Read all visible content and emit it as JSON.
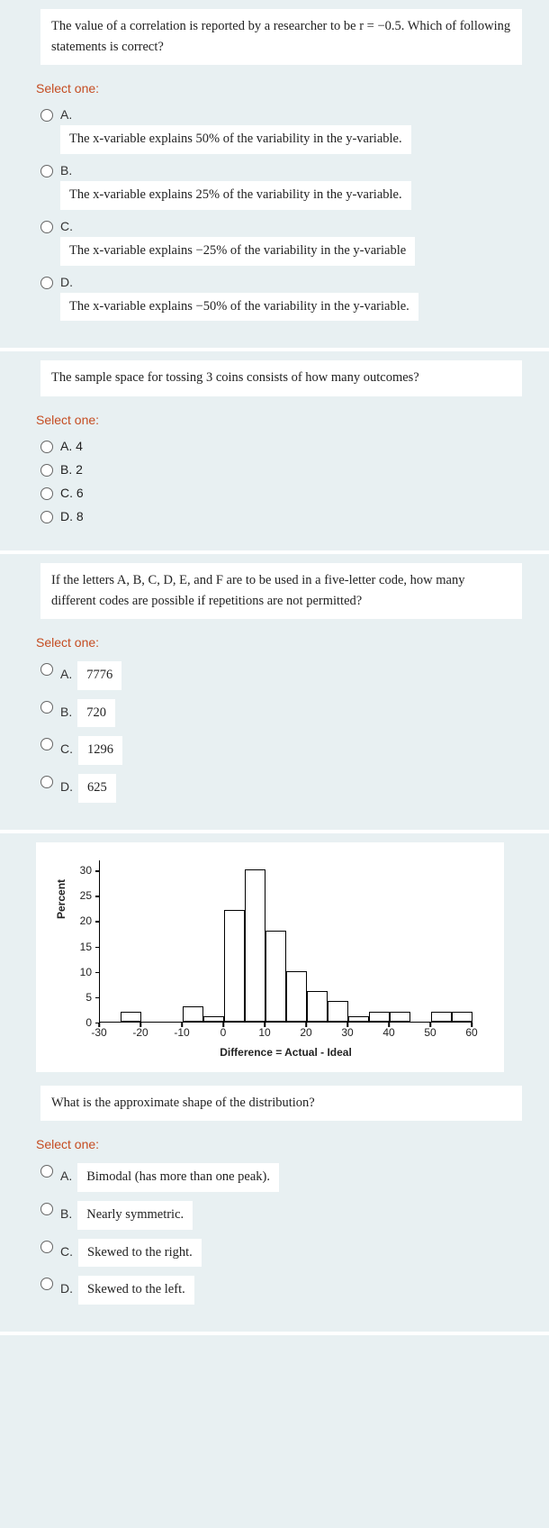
{
  "q1": {
    "prompt": "The value of a correlation is reported by a researcher to be r = −0.5. Which of following statements is correct?",
    "select": "Select one:",
    "opts": {
      "a": {
        "letter": "A.",
        "text": "The x-variable explains 50% of the variability in the y-variable."
      },
      "b": {
        "letter": "B.",
        "text": "The x-variable explains 25% of the variability in the y-variable."
      },
      "c": {
        "letter": "C.",
        "text": "The x-variable explains −25% of the variability in the y-variable"
      },
      "d": {
        "letter": "D.",
        "text": "The x-variable explains −50% of the variability in the y-variable."
      }
    }
  },
  "q2": {
    "prompt": "The sample space for tossing 3 coins consists of how many outcomes?",
    "select": "Select one:",
    "opts": {
      "a": "A. 4",
      "b": "B. 2",
      "c": "C. 6",
      "d": "D. 8"
    }
  },
  "q3": {
    "prompt": "If the letters A, B, C, D, E, and F are to be used in a five-letter code, how many different codes are possible if repetitions are not permitted?",
    "select": "Select one:",
    "opts": {
      "a": {
        "letter": "A.",
        "text": "7776"
      },
      "b": {
        "letter": "B.",
        "text": "720"
      },
      "c": {
        "letter": "C.",
        "text": "1296"
      },
      "d": {
        "letter": "D.",
        "text": "625"
      }
    }
  },
  "q4": {
    "sub_prompt": "What is the approximate shape of the distribution?",
    "select": "Select one:",
    "opts": {
      "a": {
        "letter": "A.",
        "text": "Bimodal (has more than one peak)."
      },
      "b": {
        "letter": "B.",
        "text": "Nearly symmetric."
      },
      "c": {
        "letter": "C.",
        "text": "Skewed to the right."
      },
      "d": {
        "letter": "D.",
        "text": "Skewed to the left."
      }
    }
  },
  "chart_data": {
    "type": "bar",
    "title": "",
    "ylabel": "Percent",
    "xlabel": "Difference = Actual - Ideal",
    "ylim": [
      0,
      32
    ],
    "y_ticks": [
      0,
      5,
      10,
      15,
      20,
      25,
      30
    ],
    "x_ticks": [
      -30,
      -20,
      -10,
      0,
      10,
      20,
      30,
      40,
      50,
      60
    ],
    "bin_edges": [
      -30,
      -25,
      -20,
      -15,
      -10,
      -5,
      0,
      5,
      10,
      15,
      20,
      25,
      30,
      35,
      40,
      45,
      50,
      55,
      60
    ],
    "values": [
      0,
      2,
      0,
      0,
      3,
      1,
      22,
      30,
      18,
      10,
      6,
      4,
      1,
      2,
      2,
      0,
      2,
      2
    ]
  }
}
